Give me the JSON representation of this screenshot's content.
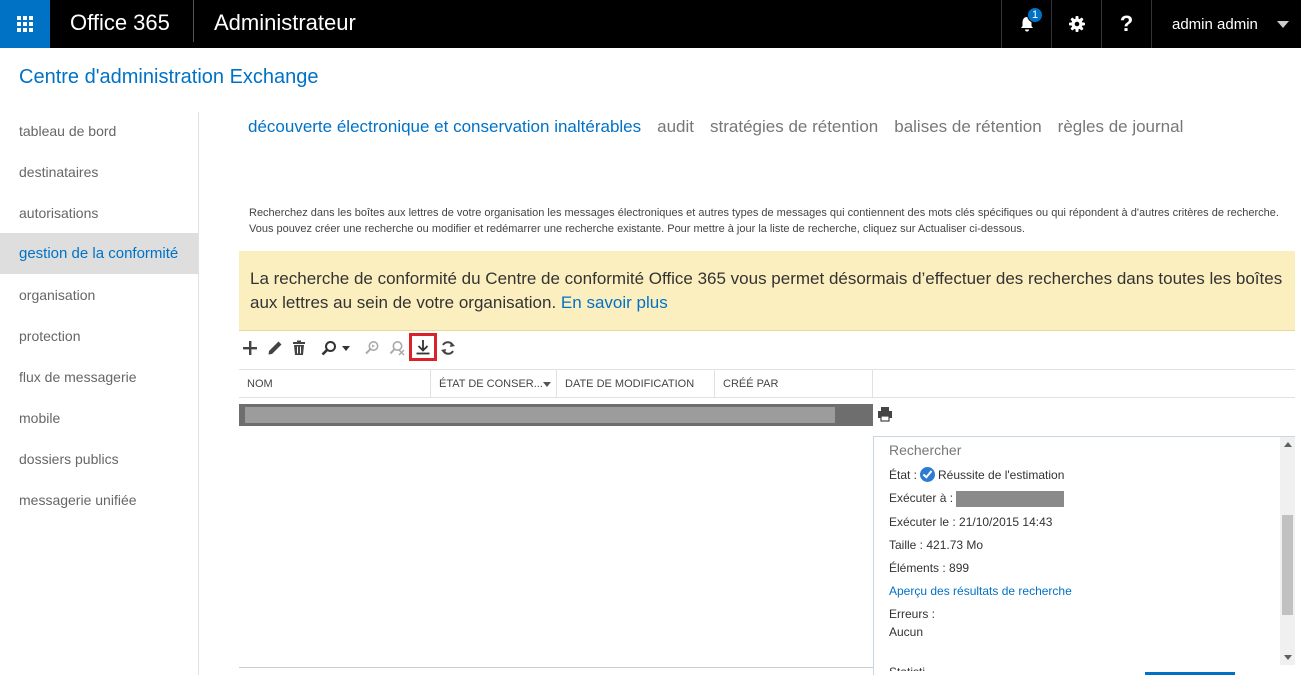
{
  "topbar": {
    "brand": "Office 365",
    "app_title": "Administrateur",
    "notification_count": "1",
    "help_glyph": "?",
    "user_name": "admin admin",
    "icons": [
      "waffle-icon",
      "bell-icon",
      "gear-icon",
      "help-icon",
      "chevron-down-icon"
    ],
    "accent_color": "#0072c6"
  },
  "page": {
    "title": "Centre d'administration Exchange"
  },
  "leftnav": {
    "items": [
      {
        "label": "tableau de bord"
      },
      {
        "label": "destinataires"
      },
      {
        "label": "autorisations"
      },
      {
        "label": "gestion de la conformité",
        "active": true
      },
      {
        "label": "organisation"
      },
      {
        "label": "protection"
      },
      {
        "label": "flux de messagerie"
      },
      {
        "label": "mobile"
      },
      {
        "label": "dossiers publics"
      },
      {
        "label": "messagerie unifiée"
      }
    ]
  },
  "tabs": [
    {
      "label": "découverte électronique et conservation inaltérables",
      "active": true
    },
    {
      "label": "audit"
    },
    {
      "label": "stratégies de rétention"
    },
    {
      "label": "balises de rétention"
    },
    {
      "label": "règles de journal"
    }
  ],
  "description": "Recherchez dans les boîtes aux lettres de votre organisation les messages électroniques et autres types de messages qui contiennent des mots clés spécifiques ou qui répondent à d'autres critères de recherche. Vous pouvez créer une recherche ou modifier et redémarrer une recherche existante. Pour mettre à jour la liste de recherche, cliquez sur Actualiser ci-dessous.",
  "banner": {
    "text": "La recherche de conformité du Centre de conformité Office 365 vous permet désormais d’effectuer des recherches dans toutes les boîtes aux lettres au sein de votre organisation.",
    "link": "En savoir plus",
    "background": "#fcefbf"
  },
  "toolbar": {
    "icons": [
      "add-icon",
      "edit-icon",
      "delete-icon",
      "search-icon",
      "chevron-down-icon",
      "estimate-icon",
      "clear-icon",
      "download-icon",
      "refresh-icon"
    ],
    "highlight_color": "#d8232a"
  },
  "list": {
    "columns": [
      "NOM",
      "ÉTAT DE CONSER...",
      "DATE DE MODIFICATION",
      "CRÉÉ PAR"
    ]
  },
  "details": {
    "title": "Rechercher",
    "state_label": "État :",
    "state_value": "Réussite de l'estimation",
    "run_as_label": "Exécuter à :",
    "run_on": "Exécuter le : 21/10/2015 14:43",
    "size": "Taille : 421.73 Mo",
    "items": "Éléments : 899",
    "preview_link": "Aperçu des résultats de recherche",
    "errors_label": "Erreurs :",
    "errors_value": "Aucun",
    "cut_text": "Statisti"
  }
}
